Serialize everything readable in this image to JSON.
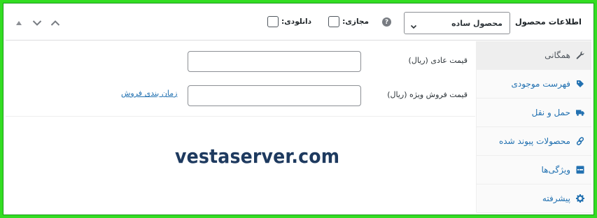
{
  "header": {
    "title": "اطلاعات محصول",
    "product_type": {
      "selected": "محصول ساده"
    },
    "help_label": "?",
    "virtual_label": "مجازی:",
    "downloadable_label": "دانلودی:",
    "virtual_checked": false,
    "downloadable_checked": false
  },
  "tabs": [
    {
      "label": "همگانی",
      "icon": "wrench-icon",
      "active": true
    },
    {
      "label": "فهرست موجودی",
      "icon": "tag-icon",
      "active": false
    },
    {
      "label": "حمل و نقل",
      "icon": "truck-icon",
      "active": false
    },
    {
      "label": "محصولات پیوند شده",
      "icon": "link-icon",
      "active": false
    },
    {
      "label": "ویژگی‌ها",
      "icon": "list-icon",
      "active": false
    },
    {
      "label": "پیشرفته",
      "icon": "gear-icon",
      "active": false
    }
  ],
  "general": {
    "regular_price_label": "قیمت عادی (ریال)",
    "regular_price_value": "",
    "sale_price_label": "قیمت فروش ویژه (ریال)",
    "sale_price_value": "",
    "schedule_link": "زمان بندی فروش"
  },
  "watermark": "vestaserver.com",
  "colors": {
    "frame": "#33dd22",
    "link": "#2271b1",
    "active_tab_bg": "#eeeeee"
  }
}
